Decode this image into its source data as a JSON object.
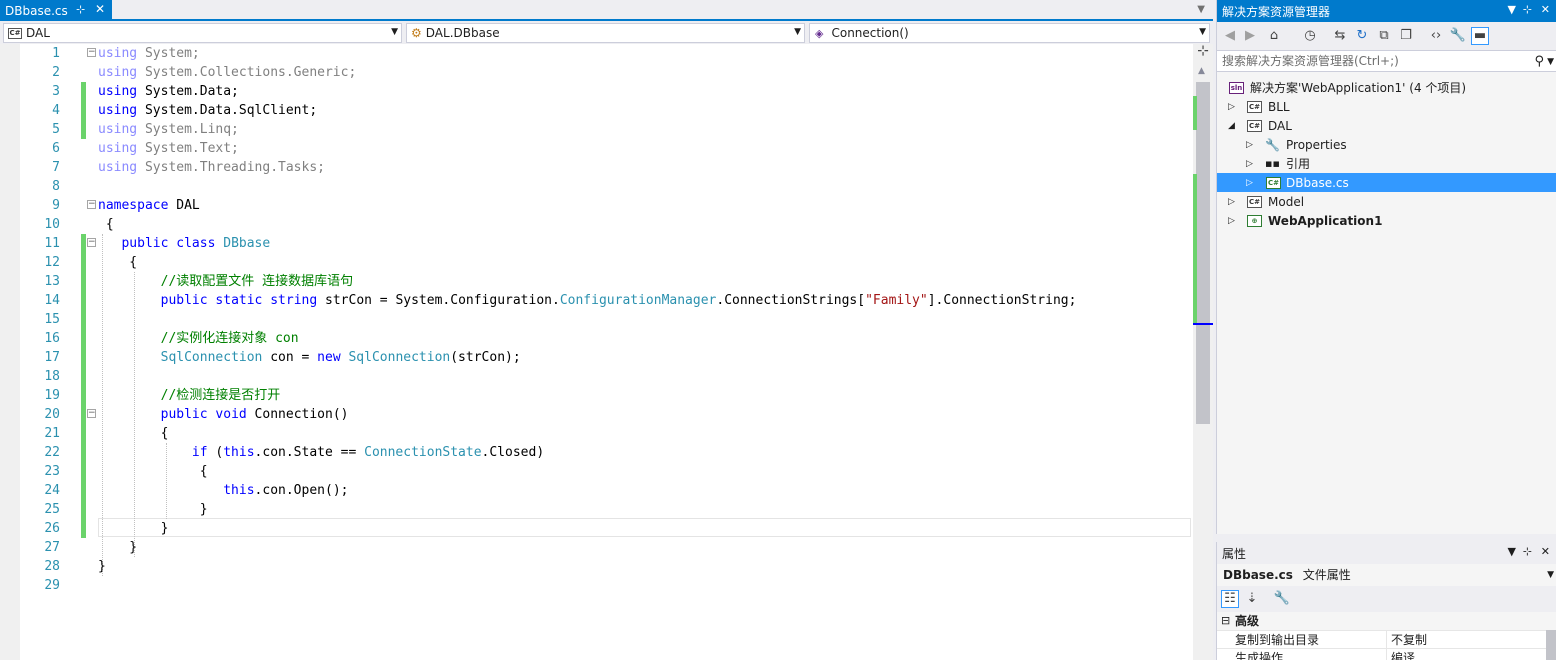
{
  "editor": {
    "tab": {
      "title": "DBbase.cs",
      "pin": "⊹",
      "close": "✕"
    },
    "nav": {
      "project": "DAL",
      "type": "DAL.DBbase",
      "member": "Connection()"
    },
    "lines": [
      {
        "n": "1",
        "html": "<span class=\"kw-dim\">using</span><span class=\"dim\"> System;</span>"
      },
      {
        "n": "2",
        "html": "<span class=\"kw-dim\">using</span><span class=\"dim\"> System.Collections.Generic;</span>"
      },
      {
        "n": "3",
        "html": "<span class=\"kw\">using</span> System.Data;"
      },
      {
        "n": "4",
        "html": "<span class=\"kw\">using</span> System.Data.SqlClient;"
      },
      {
        "n": "5",
        "html": "<span class=\"kw-dim\">using</span><span class=\"dim\"> System.Linq;</span>"
      },
      {
        "n": "6",
        "html": "<span class=\"kw-dim\">using</span><span class=\"dim\"> System.Text;</span>"
      },
      {
        "n": "7",
        "html": "<span class=\"kw-dim\">using</span><span class=\"dim\"> System.Threading.Tasks;</span>"
      },
      {
        "n": "8",
        "html": ""
      },
      {
        "n": "9",
        "html": "<span class=\"kw\">namespace</span> DAL"
      },
      {
        "n": "10",
        "html": " {"
      },
      {
        "n": "11",
        "html": "   <span class=\"kw\">public</span> <span class=\"kw\">class</span> <span class=\"type\">DBbase</span>"
      },
      {
        "n": "12",
        "html": "    {"
      },
      {
        "n": "13",
        "html": "        <span class=\"cm\">//读取配置文件 连接数据库语句</span>"
      },
      {
        "n": "14",
        "html": "        <span class=\"kw\">public</span> <span class=\"kw\">static</span> <span class=\"kw\">string</span> strCon = System.Configuration.<span class=\"type\">ConfigurationManager</span>.ConnectionStrings[<span class=\"str\">\"Family\"</span>].ConnectionString;"
      },
      {
        "n": "15",
        "html": ""
      },
      {
        "n": "16",
        "html": "        <span class=\"cm\">//实例化连接对象 con</span>"
      },
      {
        "n": "17",
        "html": "        <span class=\"type\">SqlConnection</span> con = <span class=\"kw\">new</span> <span class=\"type\">SqlConnection</span>(strCon);"
      },
      {
        "n": "18",
        "html": ""
      },
      {
        "n": "19",
        "html": "        <span class=\"cm\">//检测连接是否打开</span>"
      },
      {
        "n": "20",
        "html": "        <span class=\"kw\">public</span> <span class=\"kw\">void</span> Connection()"
      },
      {
        "n": "21",
        "html": "        {"
      },
      {
        "n": "22",
        "html": "            <span class=\"kw\">if</span> (<span class=\"kw\">this</span>.con.State == <span class=\"type\">ConnectionState</span>.Closed)"
      },
      {
        "n": "23",
        "html": "             {"
      },
      {
        "n": "24",
        "html": "                <span class=\"kw\">this</span>.con.Open();"
      },
      {
        "n": "25",
        "html": "             }"
      },
      {
        "n": "26",
        "html": "        }"
      },
      {
        "n": "27",
        "html": "    }"
      },
      {
        "n": "28",
        "html": "}"
      },
      {
        "n": "29",
        "html": ""
      }
    ]
  },
  "solution": {
    "title": "解决方案资源管理器",
    "search_placeholder": "搜索解决方案资源管理器(Ctrl+;)",
    "solution_label": "解决方案'WebApplication1' (4 个项目)",
    "nodes": {
      "bll": "BLL",
      "dal": "DAL",
      "properties": "Properties",
      "refs": "引用",
      "dbbase": "DBbase.cs",
      "model": "Model",
      "web": "WebApplication1"
    }
  },
  "properties": {
    "title": "属性",
    "object_name": "DBbase.cs",
    "object_type": "文件属性",
    "category": "高级",
    "rows": [
      {
        "name": "复制到输出目录",
        "value": "不复制"
      },
      {
        "name": "生成操作",
        "value": "编译"
      }
    ]
  },
  "colors": {
    "accent": "#007acc",
    "selection": "#3399ff",
    "change_bar": "#6bd36b"
  }
}
